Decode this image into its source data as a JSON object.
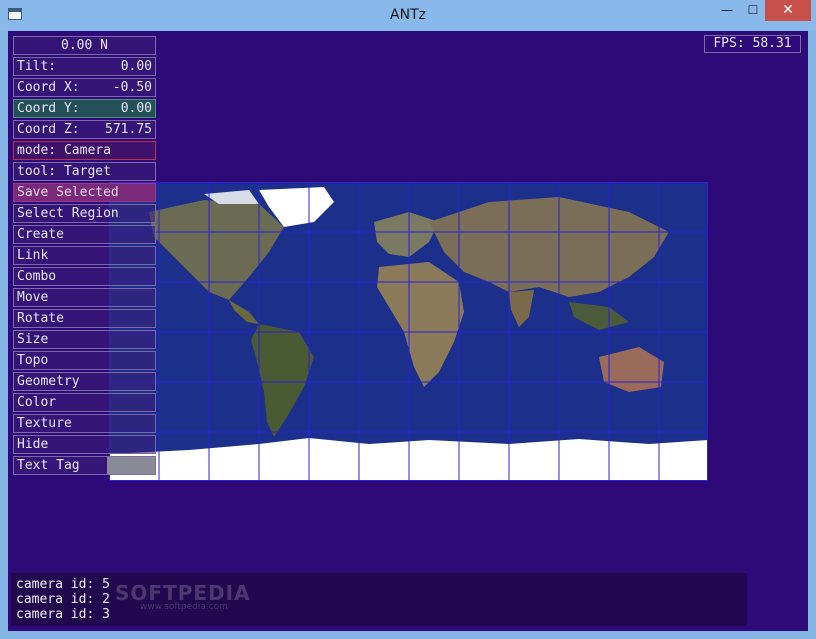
{
  "window": {
    "title": "ANTz",
    "minimize_glyph": "—",
    "maximize_glyph": "☐",
    "close_glyph": "✕"
  },
  "hud": {
    "heading": "0.00 N",
    "tilt": {
      "label": "Tilt:",
      "value": "0.00"
    },
    "coord_x": {
      "label": "Coord X:",
      "value": "-0.50"
    },
    "coord_y": {
      "label": "Coord Y:",
      "value": "0.00"
    },
    "coord_z": {
      "label": "Coord Z:",
      "value": "571.75"
    },
    "mode": "mode: Camera",
    "tool": "tool: Target",
    "buttons": [
      "Save Selected",
      "Select Region",
      "Create",
      "Link",
      "Combo",
      "Move",
      "Rotate",
      "Size",
      "Topo",
      "Geometry",
      "Color",
      "Texture",
      "Hide",
      "Text Tag"
    ]
  },
  "fps": "FPS: 58.31",
  "console": {
    "lines": [
      "camera id: 5",
      "camera id: 2",
      "camera id: 3"
    ]
  },
  "watermark": {
    "text": "SOFTPEDIA",
    "sub": "www.softpedia.com"
  },
  "colors": {
    "background": "#2e0a78",
    "grid": "#2a20d8",
    "ocean": "#1c2f8a",
    "land": "#6a6a50",
    "ice": "#ffffff"
  }
}
